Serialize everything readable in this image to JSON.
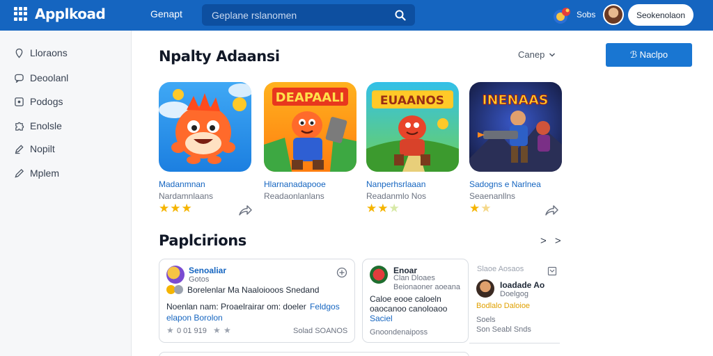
{
  "header": {
    "logo": "Applkoad",
    "nav_link": "Genapt",
    "search_placeholder": "Geplane rslanomen",
    "badge_text": "Sobs",
    "signin_label": "Seokenolaon"
  },
  "sidebar": {
    "items": [
      {
        "label": "Lloraons",
        "icon": "location-pin-icon"
      },
      {
        "label": "Deoolanl",
        "icon": "chat-bubble-icon"
      },
      {
        "label": "Podogs",
        "icon": "podcast-square-icon"
      },
      {
        "label": "Enolsle",
        "icon": "puzzle-icon"
      },
      {
        "label": "Nopilt",
        "icon": "pen-icon"
      },
      {
        "label": "Mplem",
        "icon": "pencil-icon"
      }
    ]
  },
  "main": {
    "section1_title": "Npalty Adaansi",
    "sort_label": "Canep",
    "primary_button": "ℬ Naclpo",
    "apps": [
      {
        "name": "Madanmnan",
        "sub": "Nardamnlaans",
        "rating": 3,
        "icon_text": ""
      },
      {
        "name": "Hlarnanadapooe",
        "sub": "Readaonlanlans",
        "rating": 0,
        "icon_text": "DEAPAALI"
      },
      {
        "name": "Nanperhsrlaaan",
        "sub": "Readanmlo Nos",
        "rating": 2,
        "icon_text": "EUAANOS"
      },
      {
        "name": "Sadogns e Narlnea",
        "sub": "Seaenanllns",
        "rating": 1.5,
        "icon_text": "INENAAS"
      }
    ],
    "section2_title": "Paplcirions",
    "more_label": "> >",
    "reviews": [
      {
        "name": "Senoaliar",
        "meta": "Gotos",
        "line1": "Borelenlar Ma Naaloiooos Snedand",
        "line2": "Noenlan nam: Proaelrairar om: doeler",
        "link1": "Feldgos",
        "line3": "elapon Borolon",
        "footer_left": "0 01 919",
        "footer_right": "Solad SOANOS"
      },
      {
        "name": "Enoar",
        "meta": "Clan Dloaes",
        "line1": "Beionaoner aoeana",
        "line2": "Caloe eooe caloeln",
        "line3": "oaocanoo canoloaoo",
        "link1": "Saciel",
        "footer_left": "Gnoondenaiposs"
      },
      {
        "name": "Ioadade Ao",
        "meta_top": "Slaoe Aosaos",
        "meta": "Doelgog",
        "line1": "Bodlalo Daloioe",
        "footer_top": "Soels",
        "footer_left": "Son Seabl Snds"
      }
    ]
  }
}
